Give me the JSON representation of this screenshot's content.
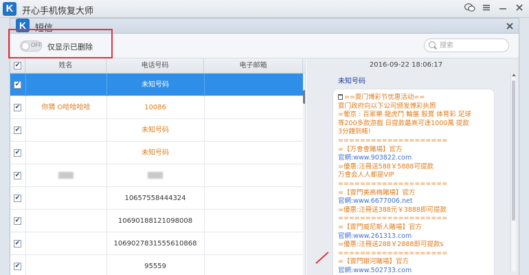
{
  "app": {
    "title": "开心手机恢复大师"
  },
  "dialog": {
    "title": "短信"
  },
  "toolbar": {
    "toggle_state": "OFF",
    "toggle_label": "仅显示已删除",
    "search_placeholder": "搜索"
  },
  "table": {
    "headers": [
      "姓名",
      "电话号码",
      "电子邮箱"
    ],
    "rows": [
      {
        "name": "",
        "phone": "未知号码",
        "email": "",
        "checked": true,
        "selected": true,
        "style": "normal",
        "name_blur": false,
        "phone_blur": false
      },
      {
        "name": "你猜 O哈哈哈哈",
        "phone": "10086",
        "email": "",
        "checked": true,
        "selected": false,
        "style": "orange",
        "name_blur": false,
        "phone_blur": false
      },
      {
        "name": "",
        "phone": "未知号码",
        "email": "",
        "checked": true,
        "selected": false,
        "style": "orange",
        "name_blur": false,
        "phone_blur": false
      },
      {
        "name": "",
        "phone": "未知号码",
        "email": "",
        "checked": true,
        "selected": false,
        "style": "orange",
        "name_blur": false,
        "phone_blur": false
      },
      {
        "name": "",
        "phone": "",
        "email": "",
        "checked": true,
        "selected": false,
        "style": "normal",
        "name_blur": true,
        "phone_blur": true
      },
      {
        "name": "",
        "phone": "10657558444324",
        "email": "",
        "checked": true,
        "selected": false,
        "style": "normal",
        "name_blur": false,
        "phone_blur": false
      },
      {
        "name": "",
        "phone": "10690188121098008",
        "email": "",
        "checked": true,
        "selected": false,
        "style": "normal",
        "name_blur": false,
        "phone_blur": false
      },
      {
        "name": "",
        "phone": "1069027831555610868",
        "email": "",
        "checked": true,
        "selected": false,
        "style": "normal",
        "name_blur": false,
        "phone_blur": false
      },
      {
        "name": "",
        "phone": "95559",
        "email": "",
        "checked": true,
        "selected": false,
        "style": "normal",
        "name_blur": false,
        "phone_blur": false
      }
    ]
  },
  "message": {
    "date": "2016-09-22 18:06:17",
    "contact": "未知号码",
    "lines": [
      {
        "text": "==賨门博彩节优惠活动==",
        "style": "orange"
      },
      {
        "text": "賨门政府向以下公司颁发博彩执照",
        "style": "orange"
      },
      {
        "text": "=葡京 : 百家樂 龍虎鬥 輪盤 股寶 体育彩 足球",
        "style": "orange"
      },
      {
        "text": "等200多款游戲 日提款最高可達1000萬 提款",
        "style": "orange"
      },
      {
        "text": "3分鐘到帳!",
        "style": "orange"
      },
      {
        "text": "====================",
        "style": "orange"
      },
      {
        "text": "=【万會會賭場】官方",
        "style": "orange"
      },
      {
        "text": "官網:www.903822.com",
        "style": "link"
      },
      {
        "text": "=優惠:注冊送588￥5888可提款",
        "style": "orange"
      },
      {
        "text": "万會会人人都是VIP",
        "style": "orange"
      },
      {
        "text": "====================",
        "style": "orange"
      },
      {
        "text": "=【賨門美高梅賭場】官方",
        "style": "orange"
      },
      {
        "text": "官網:www.6677006.net",
        "style": "link"
      },
      {
        "text": "=優惠:注冊送388元￥3888即可提款",
        "style": "orange"
      },
      {
        "text": "====================",
        "style": "orange"
      },
      {
        "text": "=【賨門威尼斯人賭場】官方",
        "style": "orange"
      },
      {
        "text": "官網:www.261313.com",
        "style": "link"
      },
      {
        "text": "=優惠:注冊送288￥2888即可提款s",
        "style": "orange"
      },
      {
        "text": "====================",
        "style": "orange"
      },
      {
        "text": "=【賨門銀河賭場】官方",
        "style": "orange"
      },
      {
        "text": "官網:www.502733.com",
        "style": "link"
      }
    ]
  },
  "icons": {
    "app_logo": "K",
    "dialog_logo": "K"
  },
  "colors": {
    "selected_row": "#2f8fe8",
    "orange_text": "#e07b1a",
    "link_text": "#3d6fd0",
    "highlight_box": "#e0323a"
  }
}
